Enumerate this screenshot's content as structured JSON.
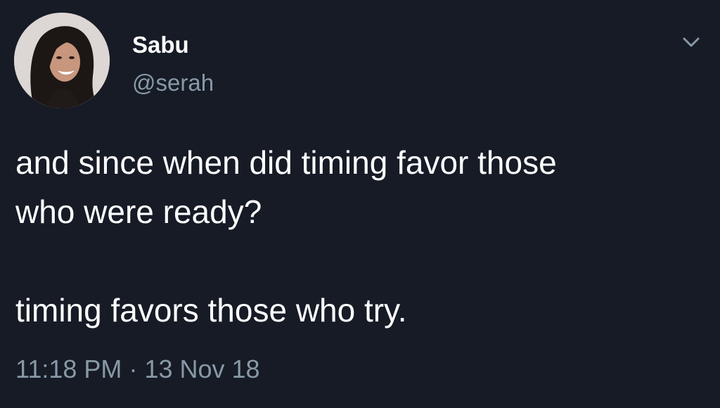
{
  "author": {
    "display_name": "Sabu",
    "handle": "@serah",
    "avatar_icon": "profile-photo-avatar"
  },
  "tweet": {
    "line1": "and since when did timing favor those",
    "line2": "who were ready?",
    "line3": "timing favors those who try.",
    "time": "11:18 PM",
    "separator": "·",
    "date": "13 Nov 18"
  },
  "icons": {
    "menu": "chevron-down-icon"
  },
  "colors": {
    "background": "#161b26",
    "primary_text": "#ffffff",
    "secondary_text": "#8899a6"
  }
}
